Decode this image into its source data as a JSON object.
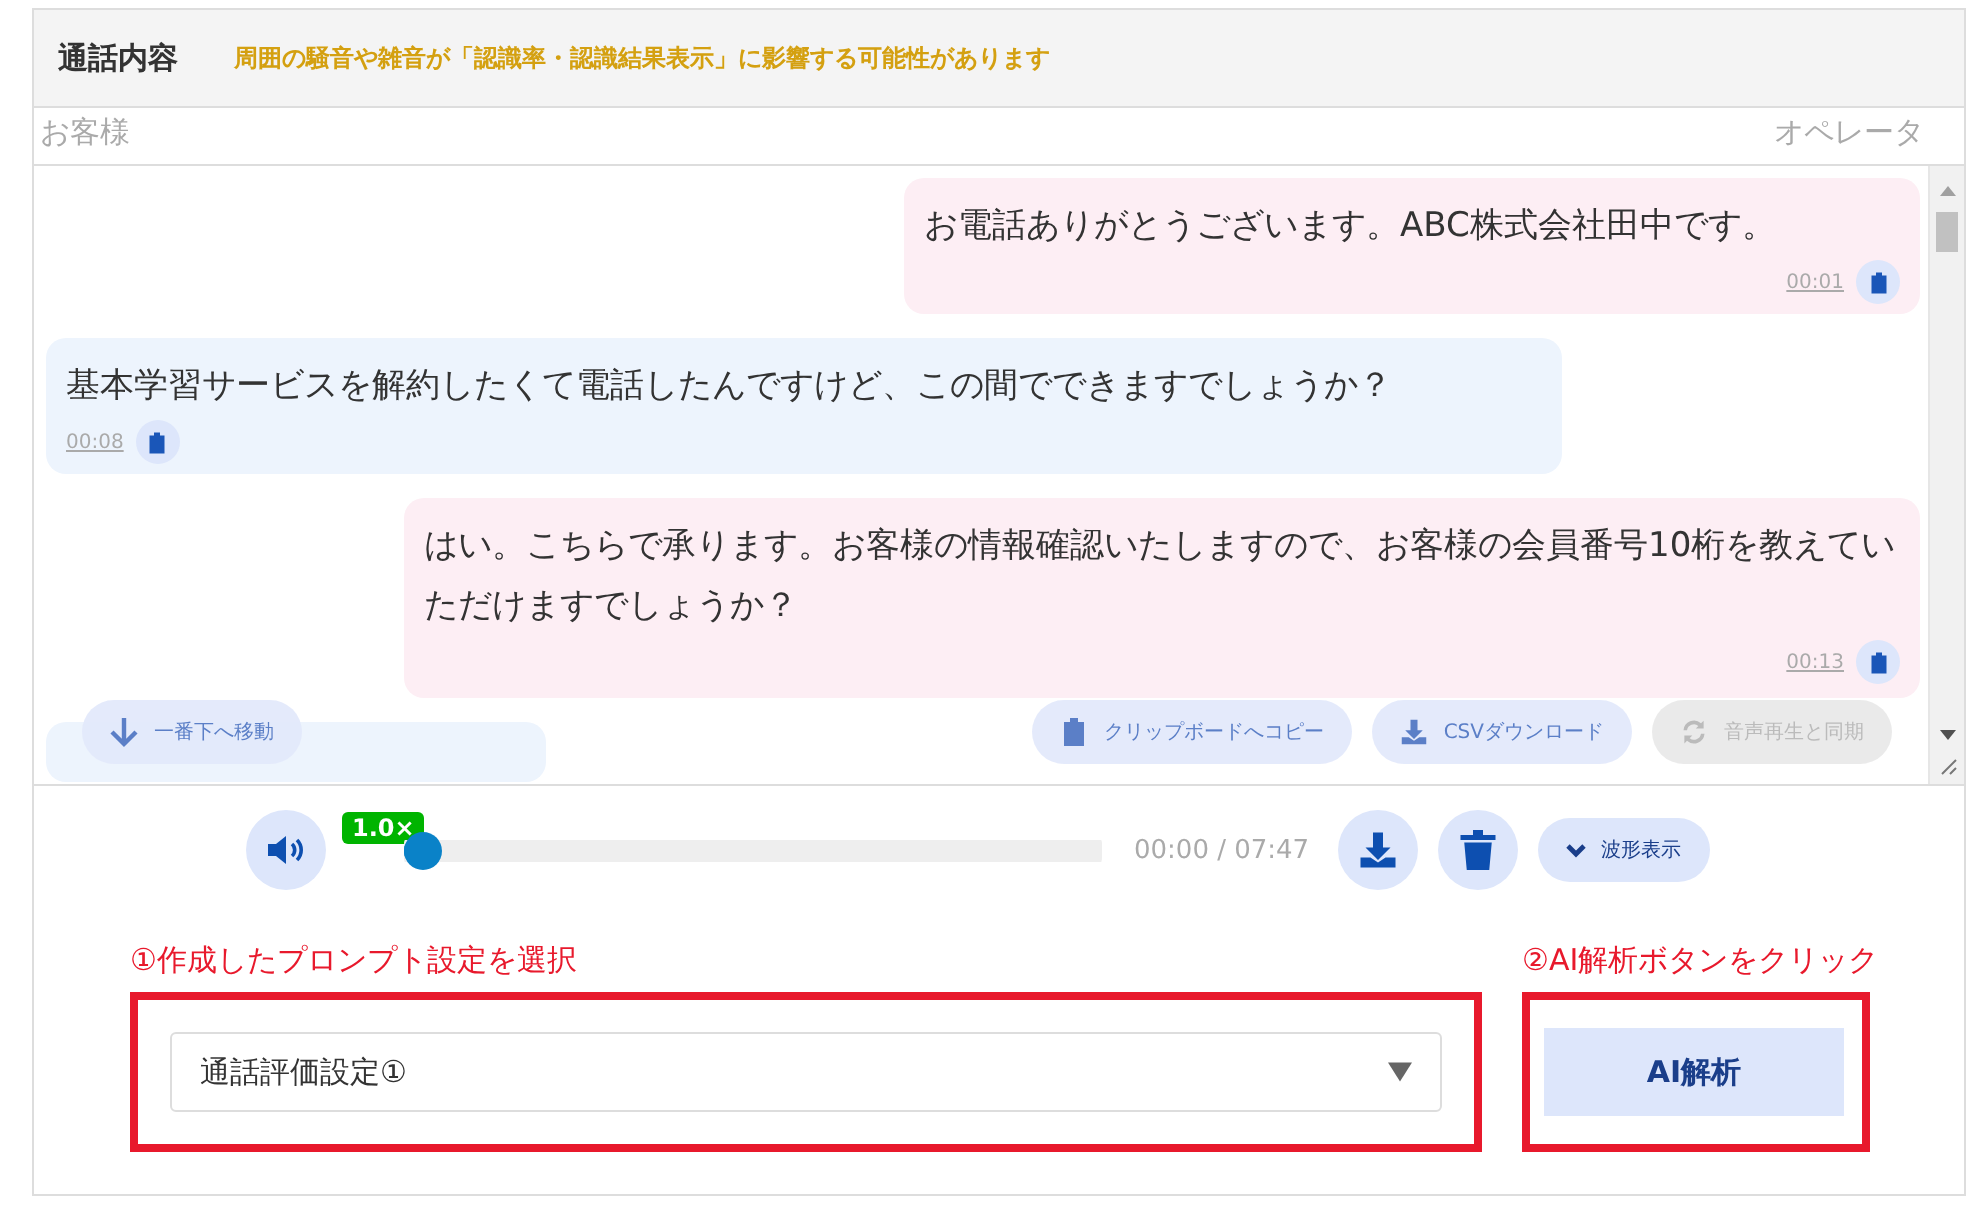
{
  "header": {
    "title": "通話内容",
    "notice": "周囲の騒音や雑音が「認識率・認識結果表示」に影響する可能性があります"
  },
  "speakers": {
    "customer": "お客様",
    "operator": "オペレータ"
  },
  "messages": [
    {
      "kind": "operator",
      "text": "お電話ありがとうございます。ABC株式会社田中です。",
      "time": "00:01"
    },
    {
      "kind": "customer",
      "text": "基本学習サービスを解約したくて電話したんですけど、この間でできますでしょうか？",
      "time": "00:08"
    },
    {
      "kind": "operator",
      "text": "はい。こちらで承ります。お客様の情報確認いたしますので、お客様の会員番号10桁を教えていただけますでしょうか？",
      "time": "00:13"
    }
  ],
  "scroll_bottom_button": "一番下へ移動",
  "actions": [
    {
      "kind": "clipboard",
      "label": "クリップボードへコピー",
      "disabled": false
    },
    {
      "kind": "download",
      "label": "CSVダウンロード",
      "disabled": false
    },
    {
      "kind": "sync",
      "label": "音声再生と同期",
      "disabled": true
    }
  ],
  "player": {
    "speed": "1.0×",
    "level": 0,
    "time": "00:00 / 07:47",
    "waveform_button": "波形表示"
  },
  "prompt": {
    "step1_label": "①作成したプロンプト設定を選択",
    "selected_setting": "通話評価設定①",
    "step2_label": "②AI解析ボタンをクリック",
    "analyze_button": "AI解析"
  }
}
